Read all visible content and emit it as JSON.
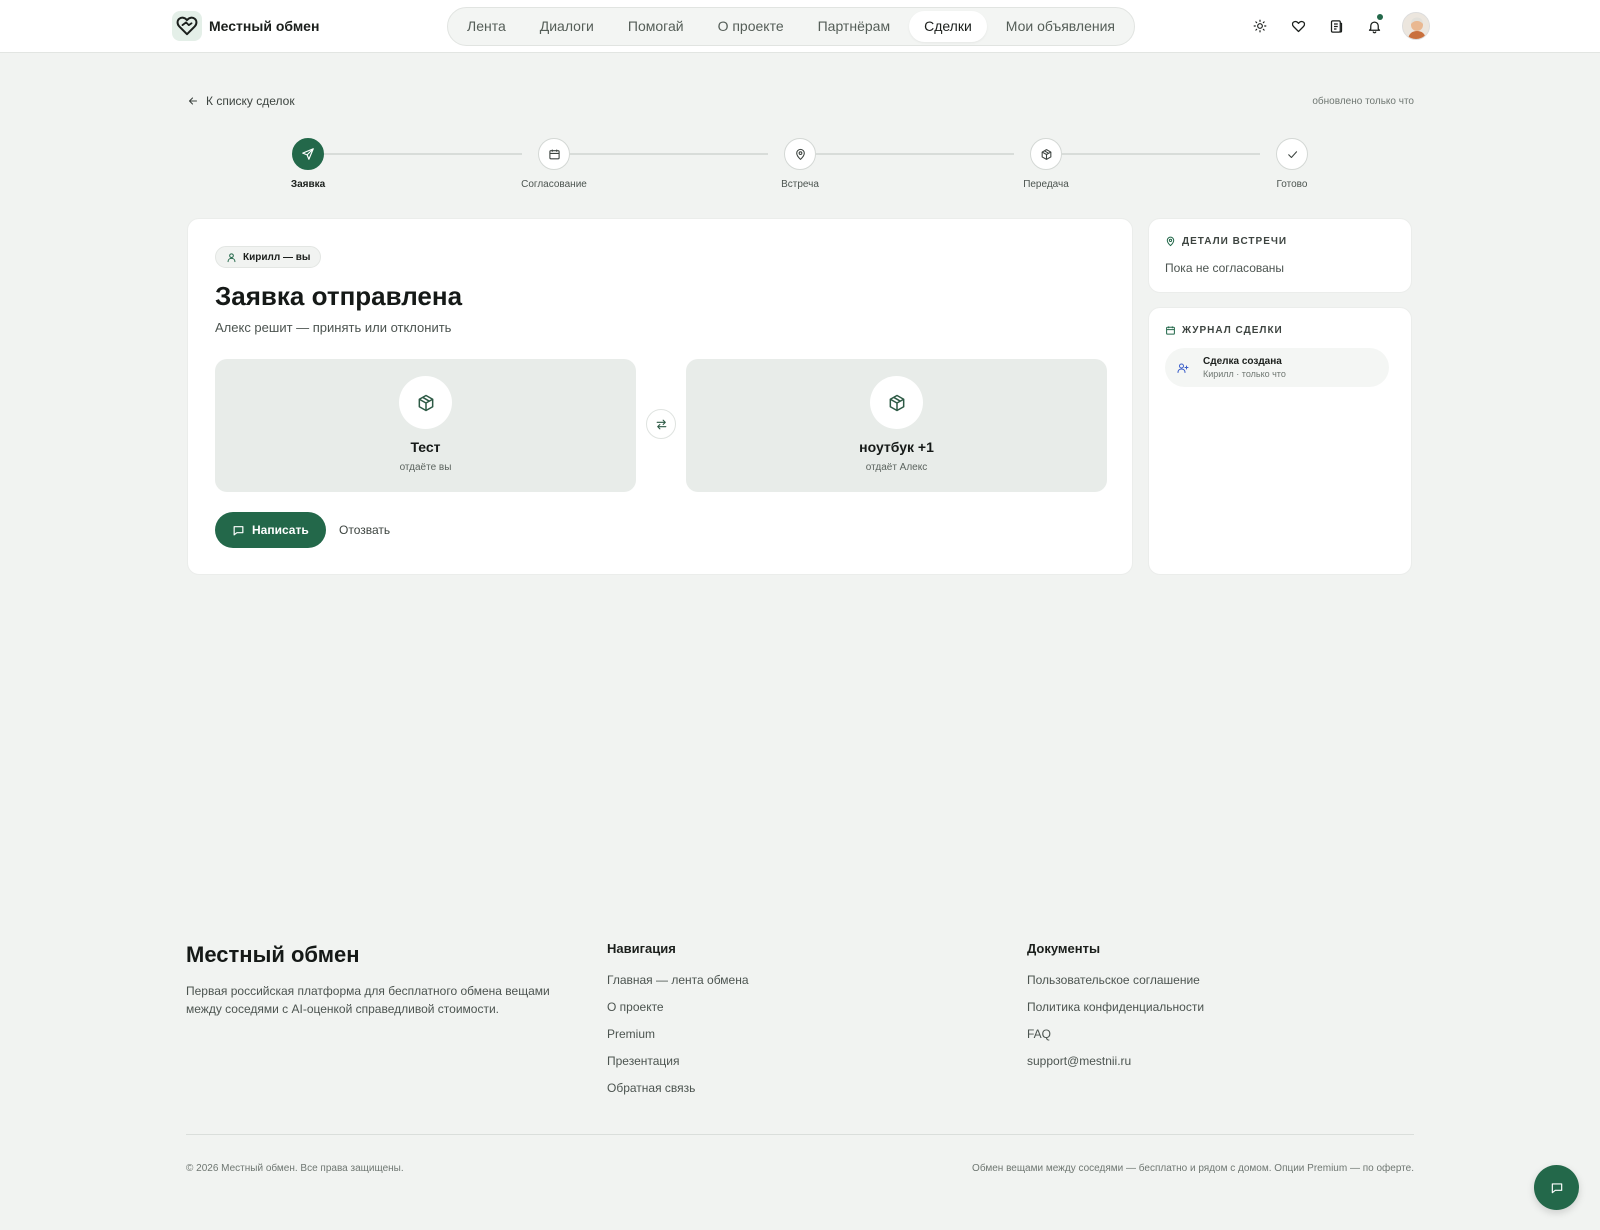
{
  "header": {
    "brand": "Местный обмен",
    "nav": [
      {
        "label": "Лента",
        "active": false
      },
      {
        "label": "Диалоги",
        "active": false
      },
      {
        "label": "Помогай",
        "active": false
      },
      {
        "label": "О проекте",
        "active": false
      },
      {
        "label": "Партнёрам",
        "active": false
      },
      {
        "label": "Сделки",
        "active": true
      },
      {
        "label": "Мои объявления",
        "active": false
      }
    ],
    "icons": [
      "sun-icon",
      "heart-icon",
      "receipt-icon",
      "bell-icon"
    ],
    "has_notification": true
  },
  "back_link": "К списку сделок",
  "updated": "обновлено только что",
  "stepper": {
    "steps": [
      {
        "label": "Заявка",
        "icon": "send-icon",
        "active": true
      },
      {
        "label": "Согласование",
        "icon": "calendar-icon",
        "active": false
      },
      {
        "label": "Встреча",
        "icon": "map-pin-icon",
        "active": false
      },
      {
        "label": "Передача",
        "icon": "package-icon",
        "active": false
      },
      {
        "label": "Готово",
        "icon": "check-icon",
        "active": false
      }
    ]
  },
  "deal": {
    "role_badge": "Кирилл — вы",
    "title": "Заявка отправлена",
    "subtitle": "Алекс решит — принять или отклонить",
    "items": [
      {
        "name": "Тест",
        "note": "отдаёте вы"
      },
      {
        "name": "ноутбук +1",
        "note": "отдаёт Алекс"
      }
    ],
    "write_label": "Написать",
    "withdraw_label": "Отозвать"
  },
  "meeting": {
    "heading": "ДЕТАЛИ ВСТРЕЧИ",
    "text": "Пока не согласованы"
  },
  "journal": {
    "heading": "ЖУРНАЛ СДЕЛКИ",
    "entries": [
      {
        "title": "Сделка создана",
        "meta": "Кирилл · только что"
      }
    ]
  },
  "footer": {
    "brand": "Местный обмен",
    "description": "Первая российская платформа для бесплатного обмена вещами между соседями с AI-оценкой справедливой стоимости.",
    "nav_heading": "Навигация",
    "nav_links": [
      "Главная — лента обмена",
      "О проекте",
      "Premium",
      "Презентация",
      "Обратная связь"
    ],
    "docs_heading": "Документы",
    "docs_links": [
      "Пользовательское соглашение",
      "Политика конфиденциальности",
      "FAQ",
      "support@mestnii.ru"
    ],
    "copyright": "© 2026 Местный обмен. Все права защищены.",
    "tagline": "Обмен вещами между соседями — бесплатно и рядом с домом. Опции Premium — по оферте."
  },
  "colors": {
    "accent": "#23684a",
    "background": "#f1f3f1",
    "item_box": "#e8ece9"
  }
}
